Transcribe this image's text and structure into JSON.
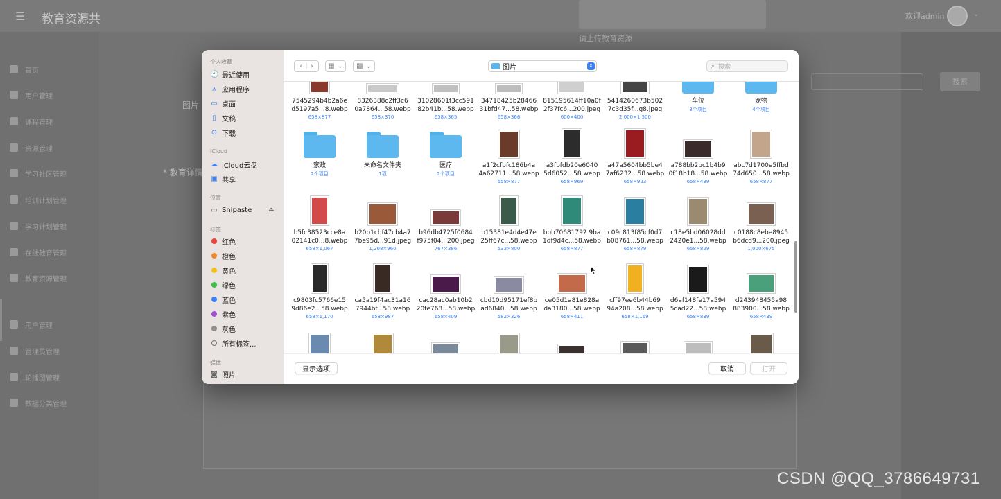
{
  "background": {
    "app_title": "教育资源共",
    "user_label": "欢迎admin",
    "menu_items": [
      "首页",
      "用户管理",
      "课程管理",
      "资源管理",
      "学习社区管理",
      "培训计划管理",
      "学习计划管理",
      "在线教育管理",
      "教育资源管理",
      "用户管理",
      "管理员管理",
      "轮播图管理",
      "数据分类管理"
    ],
    "upload_tip": "请上传教育资源",
    "field_image": "图片",
    "field_detail": "* 教育详情",
    "search_button": "搜索",
    "watermark": "CSDN @QQ_3786649731"
  },
  "dialog": {
    "sidebar": {
      "sections": {
        "favorites": "个人收藏",
        "icloud": "iCloud",
        "locations": "位置",
        "tags": "标签",
        "media": "媒体"
      },
      "favorites": [
        "最近使用",
        "应用程序",
        "桌面",
        "文稿",
        "下载"
      ],
      "icloud": [
        "iCloud云盘",
        "共享"
      ],
      "locations": [
        "Snipaste"
      ],
      "tags": [
        {
          "label": "红色",
          "color": "#e5453b"
        },
        {
          "label": "橙色",
          "color": "#f0882a"
        },
        {
          "label": "黄色",
          "color": "#f2c21b"
        },
        {
          "label": "绿色",
          "color": "#3dbf4a"
        },
        {
          "label": "蓝色",
          "color": "#3a82f6"
        },
        {
          "label": "紫色",
          "color": "#a14fd4"
        },
        {
          "label": "灰色",
          "color": "#8e8e8e"
        },
        {
          "label": "所有标签...",
          "color": ""
        }
      ],
      "media": [
        "照片"
      ]
    },
    "toolbar": {
      "location": "图片",
      "search_placeholder": "搜索"
    },
    "files": [
      {
        "name": "7545294b4b2a6e",
        "name2": "d5197a5...8.webp",
        "sub": "658×877",
        "type": "image",
        "color": "#8a3a2a"
      },
      {
        "name": "8326388c2ff3c6",
        "name2": "0a7864...58.webp",
        "sub": "658×370",
        "type": "image",
        "color": "#c9c9c9"
      },
      {
        "name": "31028601f3cc591",
        "name2": "82b41b...58.webp",
        "sub": "658×365",
        "type": "image",
        "color": "#c0c0c0"
      },
      {
        "name": "34718425b28466",
        "name2": "31bfd47...58.webp",
        "sub": "658×366",
        "type": "image",
        "color": "#bdbdbd"
      },
      {
        "name": "815195614ff10a0f",
        "name2": "2f37fc6...200.jpeg",
        "sub": "600×400",
        "type": "image",
        "color": "#cfcfcf"
      },
      {
        "name": "5414260673b502",
        "name2": "7c3d35f...g8.jpeg",
        "sub": "2,000×1,500",
        "type": "image",
        "color": "#444"
      },
      {
        "name": "车位",
        "name2": "",
        "sub": "3个项目",
        "type": "folder"
      },
      {
        "name": "宠物",
        "name2": "",
        "sub": "4个项目",
        "type": "folder"
      },
      {
        "name": "家政",
        "name2": "",
        "sub": "2个项目",
        "type": "folder"
      },
      {
        "name": "未命名文件夹",
        "name2": "",
        "sub": "1项",
        "type": "folder"
      },
      {
        "name": "医疗",
        "name2": "",
        "sub": "2个项目",
        "type": "folder"
      },
      {
        "name": "a1f2cfbfc186b4a",
        "name2": "4a62711...58.webp",
        "sub": "658×877",
        "type": "image",
        "color": "#6b3b2a"
      },
      {
        "name": "a3fbfdb20e6040",
        "name2": "5d6052...58.webp",
        "sub": "658×969",
        "type": "image",
        "color": "#2c2c2c"
      },
      {
        "name": "a47a5604bb5be4",
        "name2": "7af6232...58.webp",
        "sub": "658×923",
        "type": "image",
        "color": "#9b1c20"
      },
      {
        "name": "a788bb2bc1b4b9",
        "name2": "0f18b18...58.webp",
        "sub": "658×439",
        "type": "image",
        "color": "#3a2a2a"
      },
      {
        "name": "abc7d1700e5ffbd",
        "name2": "74d650...58.webp",
        "sub": "658×877",
        "type": "image",
        "color": "#c2a58a"
      },
      {
        "name": "b5fc38523cce8a",
        "name2": "02141c0...8.webp",
        "sub": "658×1,067",
        "type": "image",
        "color": "#d24a4a"
      },
      {
        "name": "b20b1cbf47cb4a7",
        "name2": "7be95d...91d.jpeg",
        "sub": "1,208×960",
        "type": "image",
        "color": "#9a5a3a"
      },
      {
        "name": "b96db4725f0684",
        "name2": "f975f04...200.jpeg",
        "sub": "767×386",
        "type": "image",
        "color": "#7a3a3a"
      },
      {
        "name": "b15381e4d4e47e",
        "name2": "25ff67c...58.webp",
        "sub": "533×800",
        "type": "image",
        "color": "#3a5a4a"
      },
      {
        "name": "bbb70681792 9ba",
        "name2": "1df9d4c...58.webp",
        "sub": "658×877",
        "type": "image",
        "color": "#2f8a7a"
      },
      {
        "name": "c09c813f85cf0d7",
        "name2": "b08761...58.webp",
        "sub": "658×879",
        "type": "image",
        "color": "#2a7fa0"
      },
      {
        "name": "c18e5bd06028dd",
        "name2": "2420e1...58.webp",
        "sub": "658×829",
        "type": "image",
        "color": "#9a8a70"
      },
      {
        "name": "c0188c8ebe8945",
        "name2": "b6dcd9...200.jpeg",
        "sub": "1,000×675",
        "type": "image",
        "color": "#7a6050"
      },
      {
        "name": "c9803fc5766e15",
        "name2": "9d86e2...58.webp",
        "sub": "658×1,170",
        "type": "image",
        "color": "#2a2a2a"
      },
      {
        "name": "ca5a19f4ac31a16",
        "name2": "7944bf...58.webp",
        "sub": "658×987",
        "type": "image",
        "color": "#3a2a24"
      },
      {
        "name": "cac28ac0ab10b2",
        "name2": "20fe768...58.webp",
        "sub": "658×409",
        "type": "image",
        "color": "#4a1a4a"
      },
      {
        "name": "cbd10d95171ef8b",
        "name2": "ad6840...58.webp",
        "sub": "582×326",
        "type": "image",
        "color": "#8a8aa0"
      },
      {
        "name": "ce05d1a81e828a",
        "name2": "da3180...58.webp",
        "sub": "658×411",
        "type": "image",
        "color": "#c26a4a"
      },
      {
        "name": "cff97ee6b44b69",
        "name2": "94a208...58.webp",
        "sub": "658×1,169",
        "type": "image",
        "color": "#f0b020"
      },
      {
        "name": "d6af148fe17a594",
        "name2": "5cad22...58.webp",
        "sub": "658×839",
        "type": "image",
        "color": "#1a1a1a"
      },
      {
        "name": "d243948455a98",
        "name2": "883900...58.webp",
        "sub": "658×439",
        "type": "image",
        "color": "#4aa07a"
      },
      {
        "name": "",
        "name2": "",
        "sub": "",
        "type": "image",
        "color": "#6a8ab0"
      },
      {
        "name": "",
        "name2": "",
        "sub": "",
        "type": "image",
        "color": "#b08a3a"
      },
      {
        "name": "",
        "name2": "",
        "sub": "",
        "type": "image",
        "color": "#7a8a9a"
      },
      {
        "name": "",
        "name2": "",
        "sub": "",
        "type": "image",
        "color": "#9a9a8a"
      },
      {
        "name": "",
        "name2": "",
        "sub": "",
        "type": "image",
        "color": "#3a3030"
      },
      {
        "name": "",
        "name2": "",
        "sub": "",
        "type": "image",
        "color": "#5a5a5a"
      },
      {
        "name": "",
        "name2": "",
        "sub": "",
        "type": "image",
        "color": "#bdbdbd"
      },
      {
        "name": "",
        "name2": "",
        "sub": "",
        "type": "image",
        "color": "#6a5a4a"
      }
    ],
    "footer": {
      "options_button": "显示选项",
      "cancel_button": "取消",
      "open_button": "打开"
    }
  }
}
